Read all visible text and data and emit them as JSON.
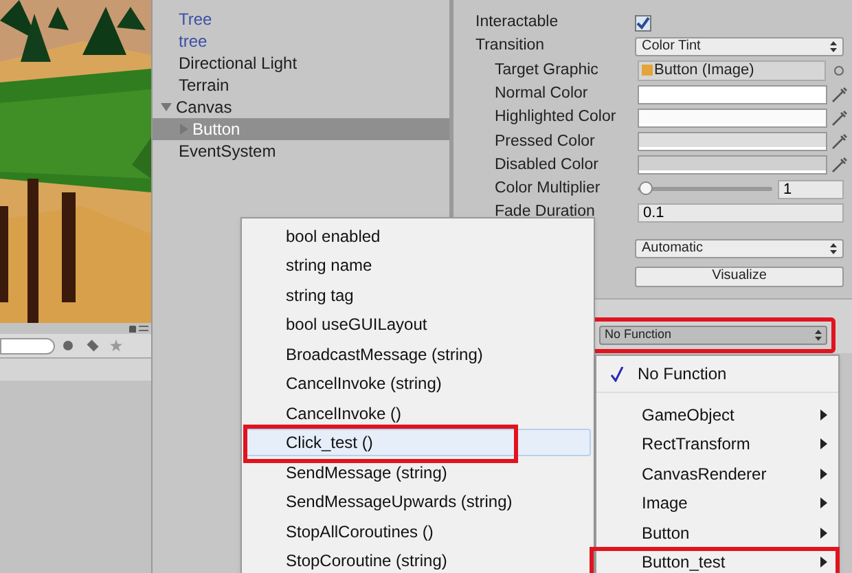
{
  "hierarchy": {
    "items": [
      {
        "label": "Tree",
        "color": "#3b4fa8",
        "selected": false
      },
      {
        "label": "tree",
        "color": "#3b4fa8",
        "selected": false
      },
      {
        "label": "Directional Light",
        "color": "#1e1e1e",
        "selected": false
      },
      {
        "label": "Terrain",
        "color": "#1e1e1e",
        "selected": false
      },
      {
        "label": "Canvas",
        "color": "#1e1e1e",
        "selected": false,
        "expanded": true,
        "children": [
          {
            "label": "Button",
            "selected": true,
            "expanded": false
          }
        ]
      },
      {
        "label": "EventSystem",
        "color": "#1e1e1e",
        "selected": false
      }
    ]
  },
  "inspector": {
    "rows": [
      {
        "kind": "checkbox",
        "label": "Interactable",
        "checked": true
      },
      {
        "kind": "dropdown",
        "label": "Transition",
        "value": "Color Tint"
      },
      {
        "kind": "object",
        "label": "Target Graphic",
        "value": "Button (Image)"
      },
      {
        "kind": "color",
        "label": "Normal Color",
        "color": "#ffffff"
      },
      {
        "kind": "color",
        "label": "Highlighted Color",
        "color": "#fafafa"
      },
      {
        "kind": "color",
        "label": "Pressed Color",
        "color": "#dedede"
      },
      {
        "kind": "color",
        "label": "Disabled Color",
        "color": "#d0d0d0"
      },
      {
        "kind": "slider",
        "label": "Color Multiplier",
        "level": 0.02,
        "value": "1"
      },
      {
        "kind": "text",
        "label": "Fade Duration",
        "value": "0.1"
      }
    ],
    "navigation": {
      "value": "Automatic"
    },
    "visualize": "Visualize",
    "function_dropdown": {
      "value": "No Function",
      "annotated": true
    }
  },
  "method_menu": {
    "items": [
      {
        "label": "bool enabled",
        "selected": false
      },
      {
        "label": "string name",
        "selected": false
      },
      {
        "label": "string tag",
        "selected": false
      },
      {
        "label": "bool useGUILayout",
        "selected": false
      },
      {
        "label": "BroadcastMessage (string)",
        "selected": false
      },
      {
        "label": "CancelInvoke (string)",
        "selected": false
      },
      {
        "label": "CancelInvoke ()",
        "selected": false
      },
      {
        "label": "Click_test ()",
        "selected": true,
        "annotated": true
      },
      {
        "label": "SendMessage (string)",
        "selected": false
      },
      {
        "label": "SendMessageUpwards (string)",
        "selected": false
      },
      {
        "label": "StopAllCoroutines ()",
        "selected": false
      },
      {
        "label": "StopCoroutine (string)",
        "selected": false
      }
    ]
  },
  "component_menu": {
    "items": [
      {
        "kind": "option",
        "label": "No Function",
        "checked": true
      },
      {
        "kind": "submenu",
        "label": "GameObject"
      },
      {
        "kind": "submenu",
        "label": "RectTransform"
      },
      {
        "kind": "submenu",
        "label": "CanvasRenderer"
      },
      {
        "kind": "submenu",
        "label": "Image"
      },
      {
        "kind": "submenu",
        "label": "Button"
      },
      {
        "kind": "submenu",
        "label": "Button_test",
        "annotated": true
      }
    ]
  }
}
